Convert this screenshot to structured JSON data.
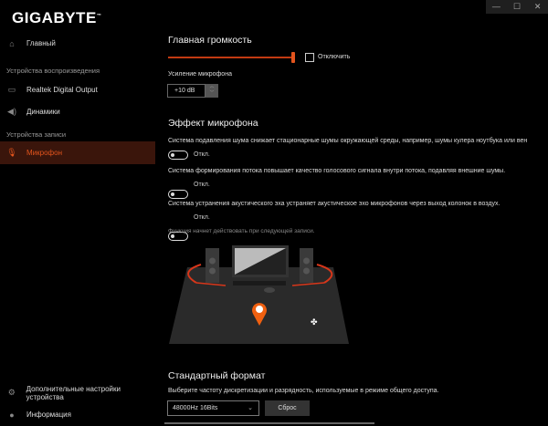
{
  "window": {
    "controls": [
      "—",
      "☐",
      "✕"
    ]
  },
  "logo": "GIGABYTE",
  "sidebar": {
    "home": "Главный",
    "playback_section": "Устройства воспроизведения",
    "playback": [
      "Realtek Digital Output",
      "Динамики"
    ],
    "record_section": "Устройства записи",
    "record": [
      "Микрофон"
    ],
    "advanced": "Дополнительные настройки устройства",
    "info": "Информация"
  },
  "main": {
    "volume_title": "Главная громкость",
    "volume_percent": 100,
    "mute_label": "Отключить",
    "boost_label": "Усиление микрофона",
    "boost_value": "+10 dB",
    "effect_title": "Эффект микрофона",
    "effects": [
      {
        "desc": "Система подавления шума снижает стационарные шумы окружающей среды, например, шумы кулера ноутбука или вен",
        "state": "Откл."
      },
      {
        "desc": "Система формирования потока повышает качество голосового сигнала внутри потока, подавляя внешние шумы.",
        "state": "Откл."
      },
      {
        "desc": "Система устранения акустического эха устраняет акустическое эхо микрофонов через выход колонок в воздух.",
        "state": "Откл."
      }
    ],
    "note": "Функция начнет действовать при следующей записи.",
    "format_title": "Стандартный формат",
    "format_desc": "Выберите частоту дискретизации и разрядность, используемые в режиме общего доступа.",
    "format_value": "48000Hz 16Bits",
    "reset_label": "Сброс"
  },
  "colors": {
    "accent": "#e2541d"
  }
}
